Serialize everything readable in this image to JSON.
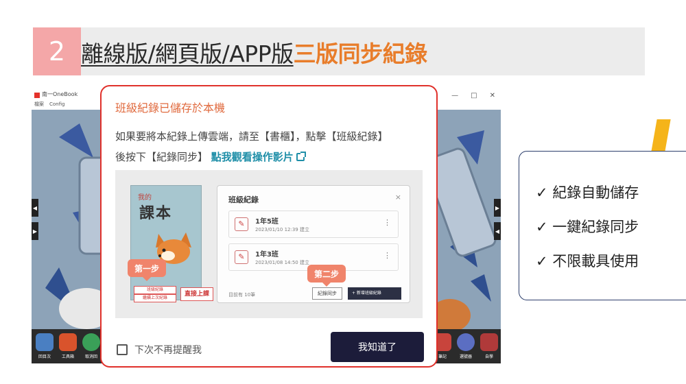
{
  "slide": {
    "step_number": "2",
    "title_plain": "離線版/網頁版/APP版",
    "title_accent": "三版同步紀錄"
  },
  "app": {
    "name": "南一OneBook",
    "menu": [
      "檔案",
      "Config"
    ],
    "window_controls": [
      "—",
      "□",
      "✕"
    ],
    "toolbar": {
      "left": [
        {
          "label": "回目次",
          "icon": "home-icon"
        },
        {
          "label": "工具箱",
          "icon": "toolbox-icon"
        },
        {
          "label": "取消回",
          "icon": "undo-icon"
        }
      ],
      "right": [
        {
          "label": "筆記",
          "icon": "note-icon"
        },
        {
          "label": "選號器",
          "icon": "picker-icon"
        },
        {
          "label": "自學",
          "icon": "book-icon"
        }
      ]
    }
  },
  "modal": {
    "title": "班級紀錄已儲存於本機",
    "body_line1": "如果要將本紀錄上傳雲端，請至【書櫃】，點擊【班級紀錄】",
    "body_line2_prefix": "後按下【紀錄同步】",
    "video_link": "點我觀看操作影片",
    "illustration": {
      "book": {
        "small_title": "我的",
        "title": "課本",
        "button_class_record": "班級紀錄",
        "button_continue": "繼續上次紀錄",
        "button_start": "直接上課"
      },
      "step1": "第一步",
      "step2": "第二步",
      "class_panel": {
        "title": "班級紀錄",
        "close": "×",
        "items": [
          {
            "name": "1年5班",
            "date": "2023/01/10 12:39 建立"
          },
          {
            "name": "1年3班",
            "date": "2023/01/08 14:50 建立"
          }
        ],
        "count": "目前有 10筆",
        "sync_button": "紀錄同步",
        "new_button": "+ 新增班級紀錄"
      }
    },
    "checkbox_label": "下次不再提醒我",
    "ok_button": "我知道了"
  },
  "features": [
    "✓ 紀錄自動儲存",
    "✓ 一鍵紀錄同步",
    "✓ 不限載具使用"
  ],
  "colors": {
    "accent_orange": "#e87d2b",
    "step_pink": "#f4a7a8",
    "modal_border": "#e0302a",
    "link_teal": "#1f8fa8",
    "button_dark": "#1c1c3a",
    "box_border": "#2c3e6b",
    "highlight_yellow": "#f5b41a"
  }
}
